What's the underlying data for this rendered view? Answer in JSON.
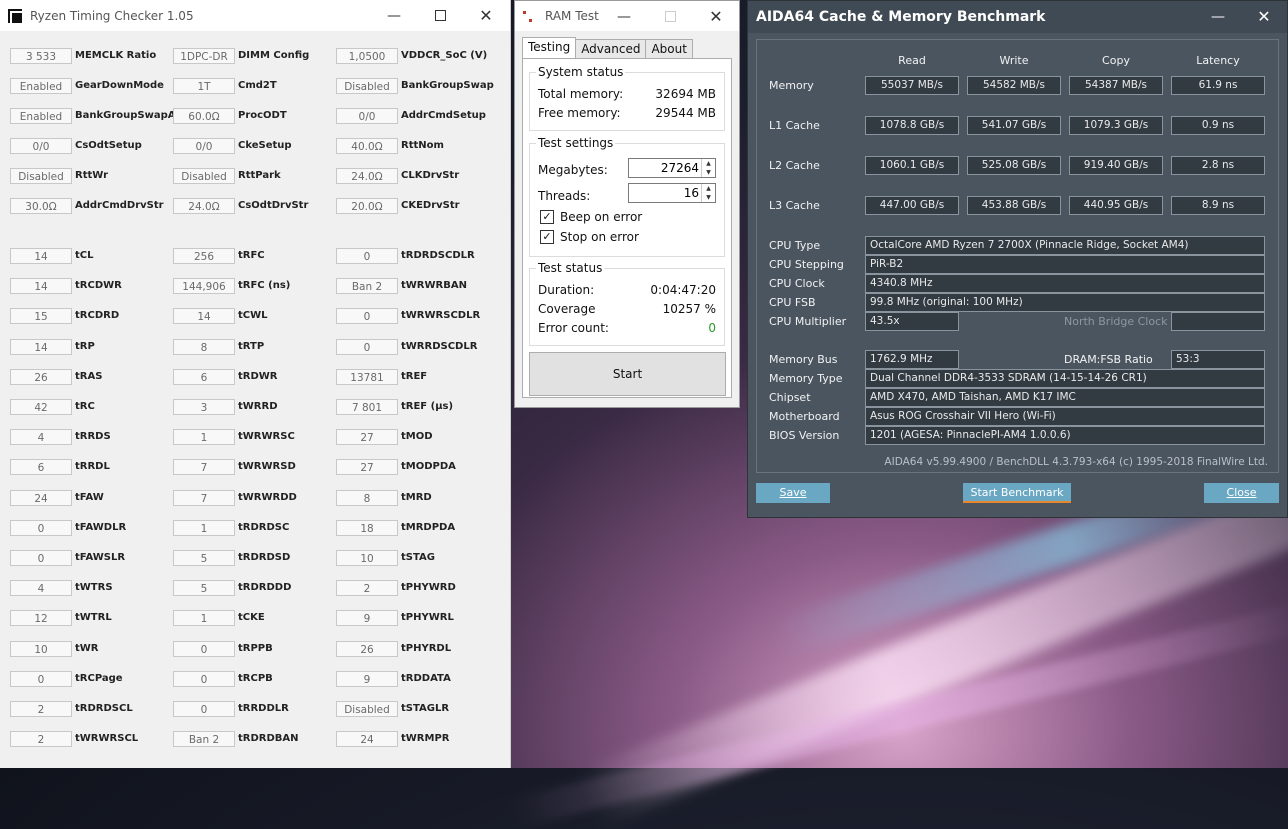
{
  "rtc": {
    "title": "Ryzen Timing Checker 1.05",
    "rows": [
      [
        [
          "3 533",
          "MEMCLK Ratio"
        ],
        [
          "1DPC-DR",
          "DIMM Config"
        ],
        [
          "1,0500",
          "VDDCR_SoC (V)"
        ]
      ],
      [
        [
          "Enabled",
          "GearDownMode"
        ],
        [
          "1T",
          "Cmd2T"
        ],
        [
          "Disabled",
          "BankGroupSwap"
        ]
      ],
      [
        [
          "Enabled",
          "BankGroupSwapAlt"
        ],
        [
          "60.0Ω",
          "ProcODT"
        ],
        [
          "0/0",
          "AddrCmdSetup"
        ]
      ],
      [
        [
          "0/0",
          "CsOdtSetup"
        ],
        [
          "0/0",
          "CkeSetup"
        ],
        [
          "40.0Ω",
          "RttNom"
        ]
      ],
      [
        [
          "Disabled",
          "RttWr"
        ],
        [
          "Disabled",
          "RttPark"
        ],
        [
          "24.0Ω",
          "CLKDrvStr"
        ]
      ],
      [
        [
          "30.0Ω",
          "AddrCmdDrvStr"
        ],
        [
          "24.0Ω",
          "CsOdtDrvStr"
        ],
        [
          "20.0Ω",
          "CKEDrvStr"
        ]
      ]
    ],
    "timings": [
      [
        [
          "14",
          "tCL"
        ],
        [
          "256",
          "tRFC"
        ],
        [
          "0",
          "tRDRDSCDLR"
        ]
      ],
      [
        [
          "14",
          "tRCDWR"
        ],
        [
          "144,906",
          "tRFC (ns)"
        ],
        [
          "Ban 2",
          "tWRWRBAN"
        ]
      ],
      [
        [
          "15",
          "tRCDRD"
        ],
        [
          "14",
          "tCWL"
        ],
        [
          "0",
          "tWRWRSCDLR"
        ]
      ],
      [
        [
          "14",
          "tRP"
        ],
        [
          "8",
          "tRTP"
        ],
        [
          "0",
          "tWRRDSCDLR"
        ]
      ],
      [
        [
          "26",
          "tRAS"
        ],
        [
          "6",
          "tRDWR"
        ],
        [
          "13781",
          "tREF"
        ]
      ],
      [
        [
          "42",
          "tRC"
        ],
        [
          "3",
          "tWRRD"
        ],
        [
          "7 801",
          "tREF (µs)"
        ]
      ],
      [
        [
          "4",
          "tRRDS"
        ],
        [
          "1",
          "tWRWRSC"
        ],
        [
          "27",
          "tMOD"
        ]
      ],
      [
        [
          "6",
          "tRRDL"
        ],
        [
          "7",
          "tWRWRSD"
        ],
        [
          "27",
          "tMODPDA"
        ]
      ],
      [
        [
          "24",
          "tFAW"
        ],
        [
          "7",
          "tWRWRDD"
        ],
        [
          "8",
          "tMRD"
        ]
      ],
      [
        [
          "0",
          "tFAWDLR"
        ],
        [
          "1",
          "tRDRDSC"
        ],
        [
          "18",
          "tMRDPDA"
        ]
      ],
      [
        [
          "0",
          "tFAWSLR"
        ],
        [
          "5",
          "tRDRDSD"
        ],
        [
          "10",
          "tSTAG"
        ]
      ],
      [
        [
          "4",
          "tWTRS"
        ],
        [
          "5",
          "tRDRDDD"
        ],
        [
          "2",
          "tPHYWRD"
        ]
      ],
      [
        [
          "12",
          "tWTRL"
        ],
        [
          "1",
          "tCKE"
        ],
        [
          "9",
          "tPHYWRL"
        ]
      ],
      [
        [
          "10",
          "tWR"
        ],
        [
          "0",
          "tRPPB"
        ],
        [
          "26",
          "tPHYRDL"
        ]
      ],
      [
        [
          "0",
          "tRCPage"
        ],
        [
          "0",
          "tRCPB"
        ],
        [
          "9",
          "tRDDATA"
        ]
      ],
      [
        [
          "2",
          "tRDRDSCL"
        ],
        [
          "0",
          "tRRDDLR"
        ],
        [
          "Disabled",
          "tSTAGLR"
        ]
      ],
      [
        [
          "2",
          "tWRWRSCL"
        ],
        [
          "Ban 2",
          "tRDRDBAN"
        ],
        [
          "24",
          "tWRMPR"
        ]
      ]
    ]
  },
  "ramtest": {
    "title": "RAM Test",
    "tabs": [
      "Testing",
      "Advanced",
      "About"
    ],
    "system_status": {
      "title": "System status",
      "total_label": "Total memory:",
      "total_value": "32694 MB",
      "free_label": "Free memory:",
      "free_value": "29544 MB"
    },
    "test_settings": {
      "title": "Test settings",
      "megabytes_label": "Megabytes:",
      "megabytes_value": "27264",
      "threads_label": "Threads:",
      "threads_value": "16",
      "beep_label": "Beep on error",
      "stop_label": "Stop on error"
    },
    "test_status": {
      "title": "Test status",
      "duration_label": "Duration:",
      "duration_value": "0:04:47:20",
      "coverage_label": "Coverage",
      "coverage_value": "10257 %",
      "error_label": "Error count:",
      "error_value": "0"
    },
    "start_label": "Start"
  },
  "aida": {
    "title": "AIDA64 Cache & Memory Benchmark",
    "columns": [
      "Read",
      "Write",
      "Copy",
      "Latency"
    ],
    "bench": [
      {
        "label": "Memory",
        "values": [
          "55037 MB/s",
          "54582 MB/s",
          "54387 MB/s",
          "61.9 ns"
        ]
      },
      {
        "label": "L1 Cache",
        "values": [
          "1078.8 GB/s",
          "541.07 GB/s",
          "1079.3 GB/s",
          "0.9 ns"
        ]
      },
      {
        "label": "L2 Cache",
        "values": [
          "1060.1 GB/s",
          "525.08 GB/s",
          "919.40 GB/s",
          "2.8 ns"
        ]
      },
      {
        "label": "L3 Cache",
        "values": [
          "447.00 GB/s",
          "453.88 GB/s",
          "440.95 GB/s",
          "8.9 ns"
        ]
      }
    ],
    "cpu": [
      {
        "label": "CPU Type",
        "value": "OctalCore AMD Ryzen 7 2700X  (Pinnacle Ridge, Socket AM4)"
      },
      {
        "label": "CPU Stepping",
        "value": "PiR-B2"
      },
      {
        "label": "CPU Clock",
        "value": "4340.8 MHz"
      },
      {
        "label": "CPU FSB",
        "value": "99.8 MHz  (original: 100 MHz)"
      }
    ],
    "multiplier_label": "CPU Multiplier",
    "multiplier_value": "43.5x",
    "nb_clock_label": "North Bridge Clock",
    "memory_bus_label": "Memory Bus",
    "memory_bus_value": "1762.9 MHz",
    "dram_ratio_label": "DRAM:FSB Ratio",
    "dram_ratio_value": "53:3",
    "sys": [
      {
        "label": "Memory Type",
        "value": "Dual Channel DDR4-3533 SDRAM  (14-15-14-26 CR1)"
      },
      {
        "label": "Chipset",
        "value": "AMD X470, AMD Taishan, AMD K17 IMC"
      },
      {
        "label": "Motherboard",
        "value": "Asus ROG Crosshair VII Hero (Wi-Fi)"
      },
      {
        "label": "BIOS Version",
        "value": "1201  (AGESA: PinnaclePI-AM4 1.0.0.6)"
      }
    ],
    "credit": "AIDA64 v5.99.4900 / BenchDLL 4.3.793-x64  (c) 1995-2018 FinalWire Ltd.",
    "save_label": "Save",
    "start_label": "Start Benchmark",
    "close_label": "Close"
  }
}
